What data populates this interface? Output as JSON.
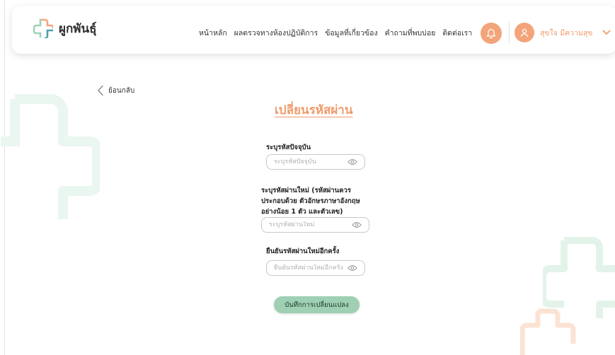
{
  "brand": {
    "name": "ผูกพันธุ์",
    "colors": {
      "mint": "#9fd0b4",
      "orange": "#f3a47a",
      "teal": "#4aa3a8"
    }
  },
  "nav": {
    "items": [
      {
        "label": "หน้าหลัก"
      },
      {
        "label": "ผลตรวจทางห้องปฏิบัติการ"
      },
      {
        "label": "ข้อมูลที่เกี่ยวข้อง"
      },
      {
        "label": "คำถามที่พบบ่อย"
      },
      {
        "label": "ติดต่อเรา"
      }
    ],
    "notification_icon": "bell-icon",
    "user": {
      "name": "สุขใจ มีความสุข",
      "icon": "user-icon",
      "dropdown_icon": "chevron-down-icon"
    }
  },
  "page": {
    "back_label": "ย้อนกลับ",
    "title": "เปลี่ยนรหัสผ่าน",
    "fields": [
      {
        "label": "ระบุรหัสปัจจุบัน",
        "placeholder": "ระบุรหัสปัจจุบัน",
        "icon": "eye-icon"
      },
      {
        "label": "ระบุรหัสผ่านใหม่ (รหัสผ่านควร ประกอบด้วย ตัวอักษรภาษาอังกฤษ อย่างน้อย 1 ตัว และตัวเลข)",
        "placeholder": "ระบุรหัสผ่านใหม่",
        "icon": "eye-icon"
      },
      {
        "label": "ยืนยันรหัสผ่านใหม่อีกครั้ง",
        "placeholder": "ยืนยันรหัสผ่านใหม่อีกครั้ง",
        "icon": "eye-icon"
      }
    ],
    "save_label": "บันทึกการเปลี่ยนแปลง"
  }
}
